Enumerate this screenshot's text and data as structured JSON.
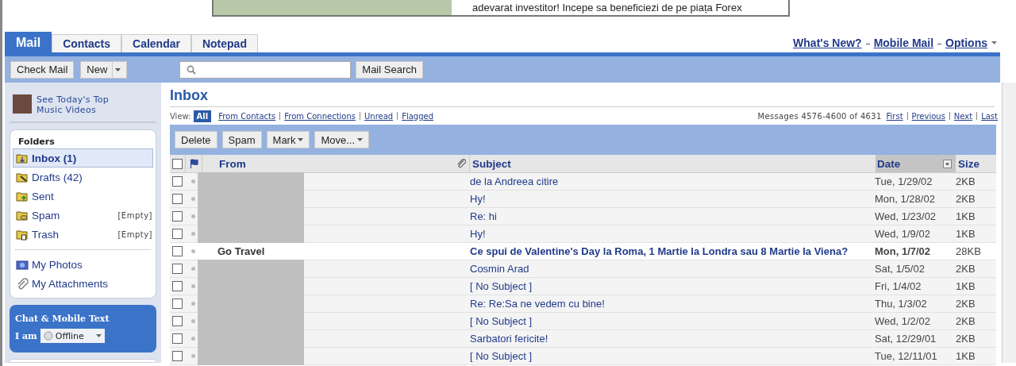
{
  "ad_banner": {
    "text": "adevarat investitor! Incepe sa beneficiezi de pe piața Forex"
  },
  "tabs": [
    {
      "label": "Mail",
      "selected": true
    },
    {
      "label": "Contacts",
      "selected": false
    },
    {
      "label": "Calendar",
      "selected": false
    },
    {
      "label": "Notepad",
      "selected": false
    }
  ],
  "top_links": [
    {
      "label": "What's New?",
      "kind": "link"
    },
    {
      "label": "Mobile Mail",
      "kind": "link"
    },
    {
      "label": "Options",
      "kind": "menu"
    }
  ],
  "toolbar": {
    "buttons": [
      {
        "label": "Check Mail",
        "kind": "plain"
      },
      {
        "label": "New",
        "kind": "split"
      }
    ],
    "search_button": "Mail Search"
  },
  "sidebar": {
    "promo": "See Today's Top Music Videos",
    "folders_title": "Folders",
    "folders": [
      {
        "name": "Inbox (1)",
        "kind": "inbox",
        "selected": true,
        "unread": true
      },
      {
        "name": "Drafts (42)",
        "kind": "drafts",
        "selected": false,
        "unread": false
      },
      {
        "name": "Sent",
        "kind": "sent",
        "selected": false,
        "unread": false
      },
      {
        "name": "Spam",
        "kind": "spam",
        "selected": false,
        "unread": false,
        "action": "[Empty]"
      },
      {
        "name": "Trash",
        "kind": "trash",
        "selected": false,
        "unread": false,
        "action": "[Empty]"
      }
    ],
    "extras": [
      {
        "label": "My Photos",
        "kind": "photos"
      },
      {
        "label": "My Attachments",
        "kind": "attachments"
      }
    ],
    "chat": {
      "title": "Chat & Mobile Text",
      "status_label": "I am",
      "status": "Offline"
    }
  },
  "inbox": {
    "title": "Inbox",
    "view_label": "View:",
    "views": [
      {
        "label": "All",
        "selected": true
      },
      {
        "label": "From Contacts",
        "selected": false
      },
      {
        "label": "From Connections",
        "selected": false
      },
      {
        "label": "Unread",
        "selected": false
      },
      {
        "label": "Flagged",
        "selected": false
      }
    ],
    "paging": {
      "summary": "Messages 4576-4600 of 4631",
      "links": [
        "First",
        "Previous",
        "Next",
        "Last"
      ]
    },
    "actions": [
      {
        "label": "Delete",
        "dropdown": false
      },
      {
        "label": "Spam",
        "dropdown": false
      },
      {
        "label": "Mark",
        "dropdown": true
      },
      {
        "label": "Move...",
        "dropdown": true
      }
    ],
    "select_all_checked": false,
    "columns": [
      {
        "label": "From",
        "kind": "from",
        "sorted": false
      },
      {
        "label": "Subject",
        "kind": "subject",
        "sorted": false
      },
      {
        "label": "Date",
        "kind": "date",
        "sorted": true
      },
      {
        "label": "Size",
        "kind": "size",
        "sorted": false
      }
    ],
    "rows": [
      {
        "redacted": true,
        "subject": "de la Andreea citire",
        "date": "Tue, 1/29/02",
        "size": "2KB",
        "unread": false,
        "checked": false
      },
      {
        "redacted": true,
        "subject": "Hy!",
        "date": "Mon, 1/28/02",
        "size": "2KB",
        "unread": false,
        "checked": false
      },
      {
        "redacted": true,
        "subject": "Re: hi",
        "date": "Wed, 1/23/02",
        "size": "1KB",
        "unread": false,
        "checked": false
      },
      {
        "redacted": true,
        "subject": "Hy!",
        "date": "Wed, 1/9/02",
        "size": "1KB",
        "unread": false,
        "checked": false
      },
      {
        "redacted": false,
        "from": "Go Travel",
        "subject": "Ce spui de Valentine's Day la Roma, 1 Martie la Londra sau 8 Martie la Viena?",
        "date": "Mon, 1/7/02",
        "size": "28KB",
        "unread": true,
        "checked": false
      },
      {
        "redacted": true,
        "subject": "Cosmin Arad",
        "date": "Sat, 1/5/02",
        "size": "2KB",
        "unread": false,
        "checked": false
      },
      {
        "redacted": true,
        "subject": "[ No Subject ]",
        "date": "Fri, 1/4/02",
        "size": "1KB",
        "unread": false,
        "checked": false
      },
      {
        "redacted": true,
        "subject": "Re: Re:Sa ne vedem cu bine!",
        "date": "Thu, 1/3/02",
        "size": "2KB",
        "unread": false,
        "checked": false
      },
      {
        "redacted": true,
        "subject": "[ No Subject ]",
        "date": "Wed, 1/2/02",
        "size": "2KB",
        "unread": false,
        "checked": false
      },
      {
        "redacted": true,
        "subject": "Sarbatori fericite!",
        "date": "Sat, 12/29/01",
        "size": "2KB",
        "unread": false,
        "checked": false
      },
      {
        "redacted": true,
        "subject": "[ No Subject ]",
        "date": "Tue, 12/11/01",
        "size": "1KB",
        "unread": false,
        "checked": false
      }
    ]
  }
}
